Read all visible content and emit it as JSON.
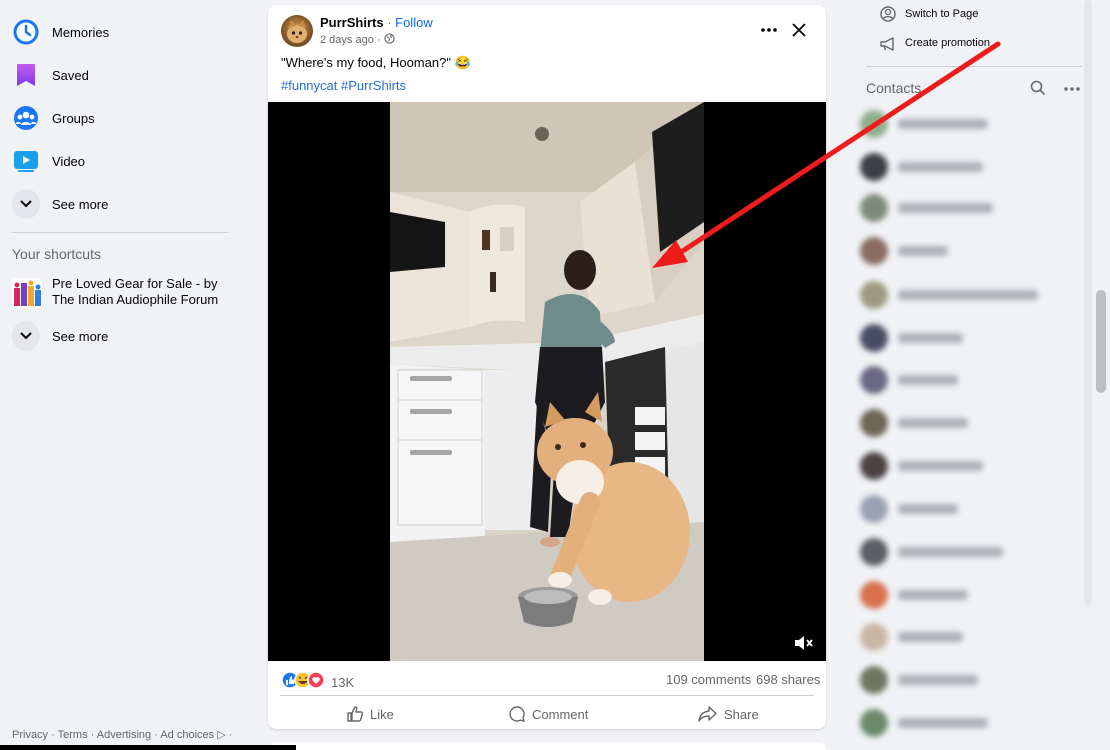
{
  "sidebar": {
    "items": [
      {
        "label": "Memories",
        "icon": "clock-icon"
      },
      {
        "label": "Saved",
        "icon": "bookmark-icon"
      },
      {
        "label": "Groups",
        "icon": "groups-icon"
      },
      {
        "label": "Video",
        "icon": "video-icon"
      }
    ],
    "see_more_1": "See more",
    "shortcuts_title": "Your shortcuts",
    "shortcut_label": "Pre Loved Gear for Sale - by The Indian Audiophile Forum",
    "see_more_2": "See more",
    "footer": "Privacy · Terms · Advertising · Ad choices ▷ ·"
  },
  "post": {
    "page_name": "PurrShirts",
    "separator": " · ",
    "follow_label": "Follow",
    "time": "2 days ago ·",
    "caption": "\"Where's my food, Hooman?\" 😂",
    "hashtags": [
      "#funnycat",
      "#PurrShirts"
    ],
    "reaction_count": "13K",
    "comments": "109 comments",
    "shares": "698 shares",
    "actions": {
      "like": "Like",
      "comment": "Comment",
      "share": "Share"
    }
  },
  "right": {
    "switch_to_page": "Switch to Page",
    "create_promotion": "Create promotion",
    "contacts_title": "Contacts"
  },
  "colors": {
    "accent": "#0866ff",
    "hashtag": "#216fdb",
    "annotation_arrow": "#ee1c1c"
  }
}
